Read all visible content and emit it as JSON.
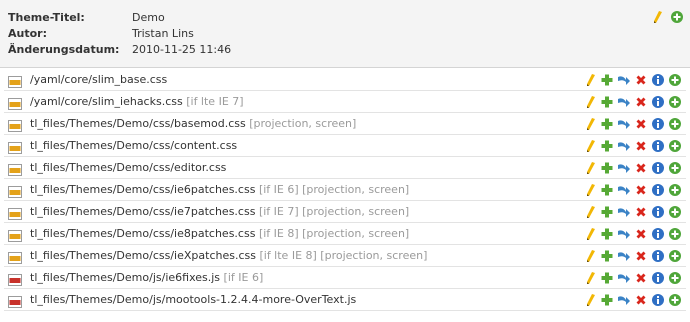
{
  "theme_info": {
    "labels": {
      "title": "Theme-Titel:",
      "author": "Autor:",
      "changed": "Änderungsdatum:"
    },
    "values": {
      "title": "Demo",
      "author": "Tristan Lins",
      "changed": "2010-11-25 11:46"
    }
  },
  "files": [
    {
      "type": "css",
      "path": "/yaml/core/slim_base.css",
      "tags": ""
    },
    {
      "type": "css",
      "path": "/yaml/core/slim_iehacks.css",
      "tags": "[if lte IE 7]"
    },
    {
      "type": "css",
      "path": "tl_files/Themes/Demo/css/basemod.css",
      "tags": "[projection, screen]"
    },
    {
      "type": "css",
      "path": "tl_files/Themes/Demo/css/content.css",
      "tags": ""
    },
    {
      "type": "css",
      "path": "tl_files/Themes/Demo/css/editor.css",
      "tags": ""
    },
    {
      "type": "css",
      "path": "tl_files/Themes/Demo/css/ie6patches.css",
      "tags": "[if IE 6] [projection, screen]"
    },
    {
      "type": "css",
      "path": "tl_files/Themes/Demo/css/ie7patches.css",
      "tags": "[if IE 7] [projection, screen]"
    },
    {
      "type": "css",
      "path": "tl_files/Themes/Demo/css/ie8patches.css",
      "tags": "[if IE 8] [projection, screen]"
    },
    {
      "type": "css",
      "path": "tl_files/Themes/Demo/css/ieXpatches.css",
      "tags": "[if lte IE 8] [projection, screen]"
    },
    {
      "type": "js",
      "path": "tl_files/Themes/Demo/js/ie6fixes.js",
      "tags": "[if IE 6]"
    },
    {
      "type": "js",
      "path": "tl_files/Themes/Demo/js/mootools-1.2.4.4-more-OverText.js",
      "tags": ""
    }
  ],
  "icons": {
    "row": [
      "edit-pencil-icon",
      "add-plus-icon",
      "move-arrow-icon",
      "delete-x-icon",
      "info-icon",
      "add-after-icon"
    ],
    "header": [
      "edit-pencil-icon",
      "add-after-icon"
    ],
    "filetype": {
      "css": "css-file-icon",
      "js": "js-file-icon"
    }
  },
  "colors": {
    "pencil": "#f2b705",
    "plus": "#56a935",
    "arrow": "#3b83c6",
    "delete": "#d9261c",
    "info": "#2f6fc4",
    "add_circle": "#4fa63a",
    "css_badge": "#e4a21a",
    "js_badge": "#c8322b"
  }
}
